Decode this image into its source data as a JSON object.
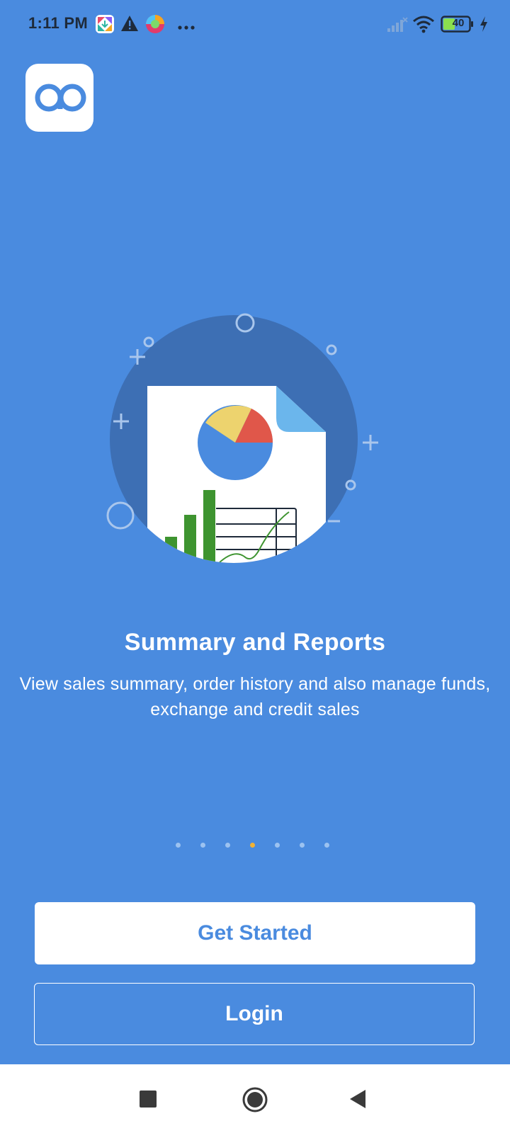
{
  "status_bar": {
    "time": "1:11 PM",
    "battery": "40",
    "icons": [
      "app-notification-icon",
      "warning-icon",
      "browser-icon",
      "more-dots-icon",
      "signal-icon",
      "wifi-icon",
      "battery-icon",
      "charging-icon"
    ]
  },
  "app": {
    "logo_icon": "app-logo-icon",
    "brand_color": "#4A8BDF"
  },
  "slide": {
    "title": "Summary and Reports",
    "description": "View sales summary, order history and also manage funds, exchange and credit sales",
    "illustration_icon": "report-document-illustration"
  },
  "pager": {
    "count": 7,
    "active_index": 3,
    "active_color": "#F2B233"
  },
  "buttons": {
    "get_started": "Get Started",
    "login": "Login"
  },
  "nav": {
    "icons": [
      "recents-square-icon",
      "home-circle-icon",
      "back-triangle-icon"
    ]
  }
}
